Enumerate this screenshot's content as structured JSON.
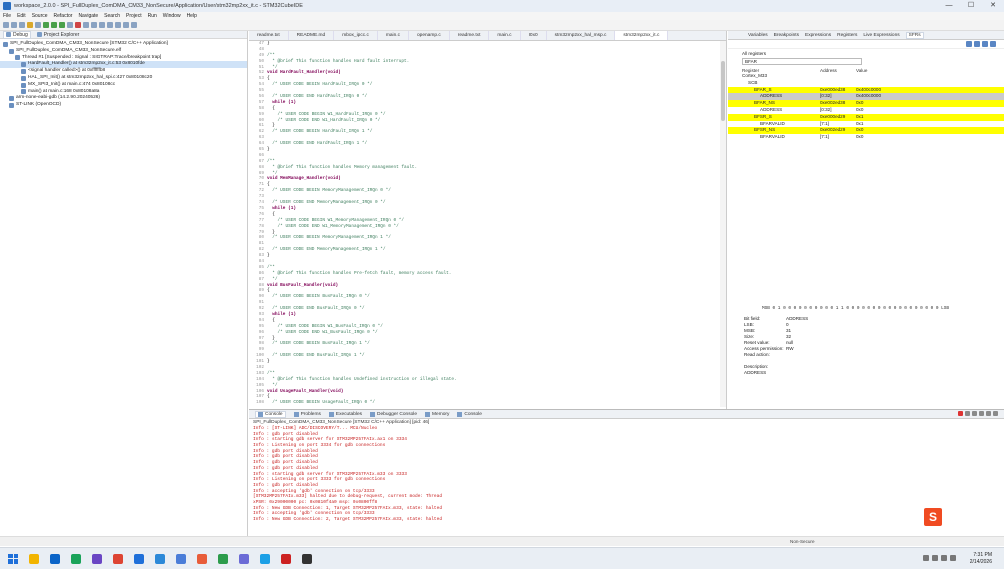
{
  "window": {
    "title": "workspace_2.0.0 - SPI_FullDuplex_ComDMA_CM33_NonSecure/Application/User/stm32mp2xx_it.c - STM32CubeIDE",
    "controls": [
      "—",
      "☐",
      "✕"
    ]
  },
  "menu": [
    "File",
    "Edit",
    "Source",
    "Refactor",
    "Navigate",
    "Search",
    "Project",
    "Run",
    "Window",
    "Help"
  ],
  "left": {
    "tabs": [
      "Debug",
      "Project Explorer"
    ],
    "tree": [
      {
        "label": "SPI_FullDuplex_ComDMA_CM33_NonSecure [STM32 C/C++ Application]",
        "indent": 0
      },
      {
        "label": "SPI_FullDuplex_ComDMA_CM33_NonSecure.elf",
        "indent": 1
      },
      {
        "label": "Thread #1 [Suspended : Signal : SIGTRAP:Trace/breakpoint trap]",
        "indent": 2
      },
      {
        "label": "HardFault_Handler() at stm32mp2xx_it.c:53 0x8010fde",
        "indent": 3,
        "selected": true
      },
      {
        "label": "<signal handler called>() at 0xffffffb8",
        "indent": 3
      },
      {
        "label": "HAL_SPI_Init() at stm32mp2xx_hal_spi.c:427 0x80108c20",
        "indent": 3
      },
      {
        "label": "MX_SPI3_Init() at main.c:474 0x80108cc",
        "indent": 3
      },
      {
        "label": "main() at main.c:168 0x80108a8a",
        "indent": 3
      },
      {
        "label": "arm-none-eabi-gdb (14.2.90.20240526)",
        "indent": 1
      },
      {
        "label": "ST-LINK (OpenOCD)",
        "indent": 1
      }
    ]
  },
  "editor": {
    "tabs": [
      "readme.txt",
      "README.md",
      "mbox_ipcc.c",
      "main.c",
      "openamp.c",
      "readme.txt",
      "main.c",
      "I0x0",
      "stm32mp2xx_hal_msp.c",
      "stm32mp2xx_it.c"
    ],
    "lines": [
      {
        "n": "47",
        "t": "}",
        "c": "tx"
      },
      {
        "n": "48",
        "t": "",
        "c": "tx"
      },
      {
        "n": "49",
        "t": "/**",
        "c": "cm"
      },
      {
        "n": "50",
        "t": "  * @brief This function handles Hard fault interrupt.",
        "c": "cm"
      },
      {
        "n": "51",
        "t": "  */",
        "c": "cm"
      },
      {
        "n": "52",
        "t": "void HardFault_Handler(void)",
        "c": "kw"
      },
      {
        "n": "53",
        "t": "{",
        "c": "tx"
      },
      {
        "n": "54",
        "t": "  /* USER CODE BEGIN HardFault_IRQn 0 */",
        "c": "cm"
      },
      {
        "n": "55",
        "t": "",
        "c": "tx"
      },
      {
        "n": "56",
        "t": "  /* USER CODE END HardFault_IRQn 0 */",
        "c": "cm"
      },
      {
        "n": "57",
        "t": "  while (1)",
        "c": "kw"
      },
      {
        "n": "58",
        "t": "  {",
        "c": "tx"
      },
      {
        "n": "59",
        "t": "    /* USER CODE BEGIN W1_HardFault_IRQn 0 */",
        "c": "cm"
      },
      {
        "n": "60",
        "t": "    /* USER CODE END W1_HardFault_IRQn 0 */",
        "c": "cm"
      },
      {
        "n": "61",
        "t": "  }",
        "c": "tx"
      },
      {
        "n": "62",
        "t": "  /* USER CODE BEGIN HardFault_IRQn 1 */",
        "c": "cm"
      },
      {
        "n": "63",
        "t": "",
        "c": "tx"
      },
      {
        "n": "64",
        "t": "  /* USER CODE END HardFault_IRQn 1 */",
        "c": "cm"
      },
      {
        "n": "65",
        "t": "}",
        "c": "tx"
      },
      {
        "n": "66",
        "t": "",
        "c": "tx"
      },
      {
        "n": "67",
        "t": "/**",
        "c": "cm"
      },
      {
        "n": "68",
        "t": "  * @brief This function handles Memory management fault.",
        "c": "cm"
      },
      {
        "n": "69",
        "t": "  */",
        "c": "cm"
      },
      {
        "n": "70",
        "t": "void MemManage_Handler(void)",
        "c": "kw"
      },
      {
        "n": "71",
        "t": "{",
        "c": "tx"
      },
      {
        "n": "72",
        "t": "  /* USER CODE BEGIN MemoryManagement_IRQn 0 */",
        "c": "cm"
      },
      {
        "n": "73",
        "t": "",
        "c": "tx"
      },
      {
        "n": "74",
        "t": "  /* USER CODE END MemoryManagement_IRQn 0 */",
        "c": "cm"
      },
      {
        "n": "75",
        "t": "  while (1)",
        "c": "kw"
      },
      {
        "n": "76",
        "t": "  {",
        "c": "tx"
      },
      {
        "n": "77",
        "t": "    /* USER CODE BEGIN W1_MemoryManagement_IRQn 0 */",
        "c": "cm"
      },
      {
        "n": "78",
        "t": "    /* USER CODE END W1_MemoryManagement_IRQn 0 */",
        "c": "cm"
      },
      {
        "n": "79",
        "t": "  }",
        "c": "tx"
      },
      {
        "n": "80",
        "t": "  /* USER CODE BEGIN MemoryManagement_IRQn 1 */",
        "c": "cm"
      },
      {
        "n": "81",
        "t": "",
        "c": "tx"
      },
      {
        "n": "82",
        "t": "  /* USER CODE END MemoryManagement_IRQn 1 */",
        "c": "cm"
      },
      {
        "n": "83",
        "t": "}",
        "c": "tx"
      },
      {
        "n": "84",
        "t": "",
        "c": "tx"
      },
      {
        "n": "85",
        "t": "/**",
        "c": "cm"
      },
      {
        "n": "86",
        "t": "  * @brief This function handles Pre-fetch fault, memory access fault.",
        "c": "cm"
      },
      {
        "n": "87",
        "t": "  */",
        "c": "cm"
      },
      {
        "n": "88",
        "t": "void BusFault_Handler(void)",
        "c": "kw"
      },
      {
        "n": "89",
        "t": "{",
        "c": "tx"
      },
      {
        "n": "90",
        "t": "  /* USER CODE BEGIN BusFault_IRQn 0 */",
        "c": "cm"
      },
      {
        "n": "91",
        "t": "",
        "c": "tx"
      },
      {
        "n": "92",
        "t": "  /* USER CODE END BusFault_IRQn 0 */",
        "c": "cm"
      },
      {
        "n": "93",
        "t": "  while (1)",
        "c": "kw"
      },
      {
        "n": "94",
        "t": "  {",
        "c": "tx"
      },
      {
        "n": "95",
        "t": "    /* USER CODE BEGIN W1_BusFault_IRQn 0 */",
        "c": "cm"
      },
      {
        "n": "96",
        "t": "    /* USER CODE END W1_BusFault_IRQn 0 */",
        "c": "cm"
      },
      {
        "n": "97",
        "t": "  }",
        "c": "tx"
      },
      {
        "n": "98",
        "t": "  /* USER CODE BEGIN BusFault_IRQn 1 */",
        "c": "cm"
      },
      {
        "n": "99",
        "t": "",
        "c": "tx"
      },
      {
        "n": "100",
        "t": "  /* USER CODE END BusFault_IRQn 1 */",
        "c": "cm"
      },
      {
        "n": "101",
        "t": "}",
        "c": "tx"
      },
      {
        "n": "102",
        "t": "",
        "c": "tx"
      },
      {
        "n": "103",
        "t": "/**",
        "c": "cm"
      },
      {
        "n": "104",
        "t": "  * @brief This function handles Undefined instruction or illegal state.",
        "c": "cm"
      },
      {
        "n": "105",
        "t": "  */",
        "c": "cm"
      },
      {
        "n": "106",
        "t": "void UsageFault_Handler(void)",
        "c": "kw"
      },
      {
        "n": "107",
        "t": "{",
        "c": "tx"
      },
      {
        "n": "108",
        "t": "  /* USER CODE BEGIN UsageFault_IRQn 0 */",
        "c": "cm"
      }
    ]
  },
  "right": {
    "tabs": [
      "Variables",
      "Breakpoints",
      "Expressions",
      "Registers",
      "Live Expressions",
      "SFRs"
    ],
    "search_label": "All registers",
    "search_value": "BFAR",
    "columns": [
      "Register",
      "Address",
      "Value"
    ],
    "rows": [
      {
        "name": "Cortex_M33",
        "addr": "",
        "val": "",
        "indent": 0,
        "style": ""
      },
      {
        "name": "SCB",
        "addr": "",
        "val": "",
        "indent": 1,
        "style": ""
      },
      {
        "name": "BFAR_S",
        "addr": "0xe000ed38",
        "val": "0x400c0000",
        "indent": 2,
        "style": "hl"
      },
      {
        "name": "ADDRESS",
        "addr": "[0:32]",
        "val": "0x400c0000",
        "indent": 3,
        "style": "sel"
      },
      {
        "name": "BFAR_NS",
        "addr": "0xe002ed38",
        "val": "0x0",
        "indent": 2,
        "style": "hl"
      },
      {
        "name": "ADDRESS",
        "addr": "[0:32]",
        "val": "0x0",
        "indent": 3,
        "style": ""
      },
      {
        "name": "BFSR_S",
        "addr": "0xe000ed29",
        "val": "0x1",
        "indent": 2,
        "style": "hl"
      },
      {
        "name": "BFARVALID",
        "addr": "[7:1]",
        "val": "0x1",
        "indent": 3,
        "style": ""
      },
      {
        "name": "BFSR_NS",
        "addr": "0xe002ed29",
        "val": "0x0",
        "indent": 2,
        "style": "hl"
      },
      {
        "name": "BFARVALID",
        "addr": "[7:1]",
        "val": "0x0",
        "indent": 3,
        "style": ""
      }
    ],
    "bits": "MSB 0 1 0 0 0 0 0 0 0 0 0 0 1 1 0 0 0 0 0 0 0 0 0 0 0 0 0 0 0 0 0 0 LSB",
    "details": [
      {
        "k": "Bit field:",
        "v": "ADDRESS"
      },
      {
        "k": "LSB:",
        "v": "0"
      },
      {
        "k": "MSB:",
        "v": "31"
      },
      {
        "k": "Size:",
        "v": "32"
      },
      {
        "k": "Reset value:",
        "v": "null"
      },
      {
        "k": "Access permission:",
        "v": "RW"
      },
      {
        "k": "Read action:",
        "v": ""
      },
      {
        "k": "",
        "v": ""
      },
      {
        "k": "Description:",
        "v": ""
      },
      {
        "k": "ADDRESS",
        "v": ""
      }
    ]
  },
  "console": {
    "tabs": [
      "Console",
      "Problems",
      "Executables",
      "Debugger Console",
      "Memory",
      "Console"
    ],
    "header": "SPI_FullDuplex_ComDMA_CM33_NonSecure [STM32 C/C++ Application] [pid: 46]",
    "lines": [
      "Info : [ST-LINK] ADC/DISCOVERY/T... MCU/Nucleo",
      "Info : gdb port disabled",
      "Info : starting gdb server for STM32MP257FAIx.ax1 on 3334",
      "Info : Listening on port 3334 for gdb connections",
      "Info : gdb port disabled",
      "Info : gdb port disabled",
      "Info : gdb port disabled",
      "Info : gdb port disabled",
      "Info : starting gdb server for STM32MP257FAIx.m33 on 3333",
      "Info : Listening on port 3333 for gdb connections",
      "Info : gdb port disabled",
      "Info : accepting 'gdb' connection on tcp/3333",
      "[STM32MP257FAIx.m33] halted due to debug-request, current mode: Thread",
      "xPSR: 0x29000000 pc: 0x0810f4a0 msp: 0x0800ff8",
      "Info : New GDB Connection: 1, Target STM32MP257FAIx.m33, state: halted",
      "Info : accepting 'gdb' connection on tcp/3333",
      "Info : New GDB Connection: 2, Target STM32MP257FAIx.m33, state: halted"
    ]
  },
  "status": {
    "text": "Non-Secure"
  },
  "taskbar": {
    "time": "7:31 PM",
    "date": "2/14/2026",
    "apps": [
      "#f2b400",
      "#0a64c8",
      "#1aa35a",
      "#6a46c4",
      "#d43",
      "#1e6fd9",
      "#2b88d8",
      "#4a7dd8",
      "#e85d3a",
      "#2c9c4c",
      "#6b6bd6",
      "#1ca0e6",
      "#c22",
      "#333"
    ]
  }
}
